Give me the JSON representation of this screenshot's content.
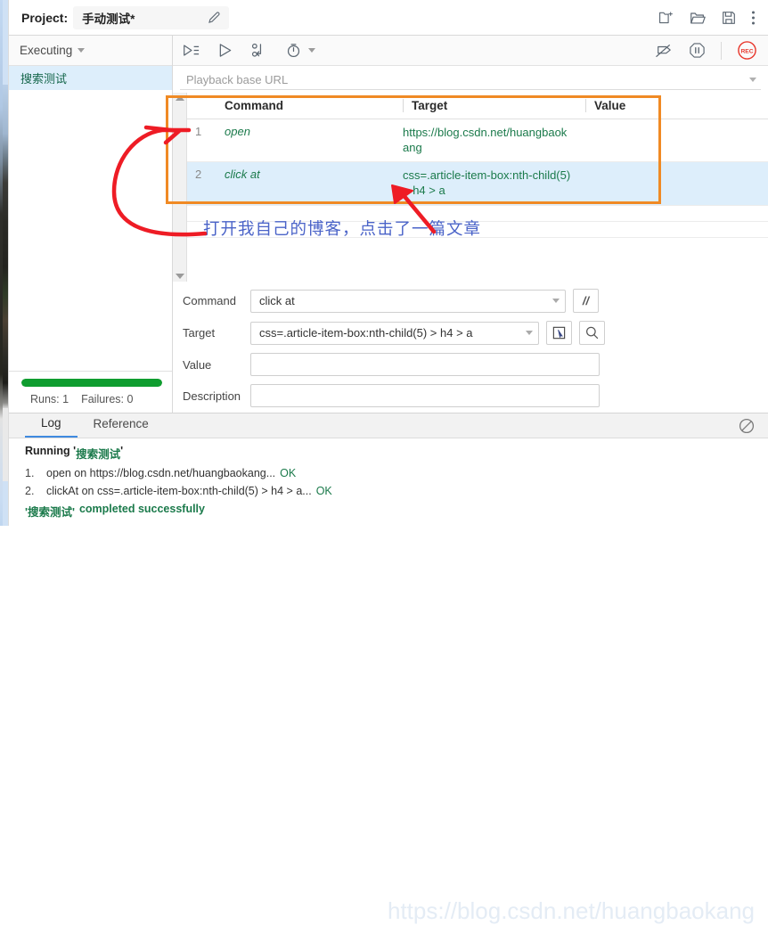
{
  "header": {
    "project_label": "Project:",
    "project_name": "手动测试*",
    "edit_icon": "pencil-icon",
    "icons": [
      "new-project-icon",
      "open-project-icon",
      "save-project-icon",
      "more-options-icon"
    ]
  },
  "left_panel": {
    "execution_mode": "Executing",
    "tests": [
      {
        "name": "搜索测试",
        "selected": true
      }
    ],
    "progress_percent": 100,
    "progress_color": "#0f9d2f",
    "runs_label": "Runs: 1",
    "failures_label": "Failures: 0"
  },
  "playback_toolbar": {
    "icons": [
      "run-all-tests-icon",
      "run-current-test-icon",
      "step-icon",
      "speed-icon"
    ],
    "right_icons": [
      "disable-breakpoints-icon",
      "pause-icon",
      "record-icon"
    ],
    "record_label": "REC"
  },
  "base_url": {
    "placeholder": "Playback base URL",
    "value": ""
  },
  "commands_table": {
    "columns": [
      "Command",
      "Target",
      "Value"
    ],
    "rows": [
      {
        "num": "1",
        "command": "open",
        "target": "https://blog.csdn.net/huangbaokang",
        "value": "",
        "selected": false
      },
      {
        "num": "2",
        "command": "click at",
        "target": "css=.article-item-box:nth-child(5) > h4 > a",
        "value": "",
        "selected": true
      }
    ]
  },
  "annotation": {
    "text": "打开我自己的博客，点击了一篇文章",
    "text_color": "#4a63c8",
    "box_color": "#f08a24",
    "arrow_color": "#ee1c25"
  },
  "form": {
    "command_label": "Command",
    "command_value": "click at",
    "comment_button": "//",
    "target_label": "Target",
    "target_value": "css=.article-item-box:nth-child(5) > h4 > a",
    "select_target_icon": "select-target-icon",
    "find_target_icon": "find-target-icon",
    "value_label": "Value",
    "value_value": "",
    "description_label": "Description",
    "description_value": ""
  },
  "log_panel": {
    "tabs": [
      {
        "label": "Log",
        "active": true
      },
      {
        "label": "Reference",
        "active": false
      }
    ],
    "clear_icon": "clear-log-icon",
    "running_prefix": "Running '",
    "running_test": "搜索测试",
    "running_suffix": "'",
    "entries": [
      {
        "num": "1.",
        "text": "open on https://blog.csdn.net/huangbaokang...",
        "status": "OK"
      },
      {
        "num": "2.",
        "text": "clickAt on css=.article-item-box:nth-child(5) > h4 > a...",
        "status": "OK"
      }
    ],
    "completed_test": "'搜索测试'",
    "completed_text": "completed successfully"
  },
  "watermark": "https://blog.csdn.net/huangbaokang"
}
